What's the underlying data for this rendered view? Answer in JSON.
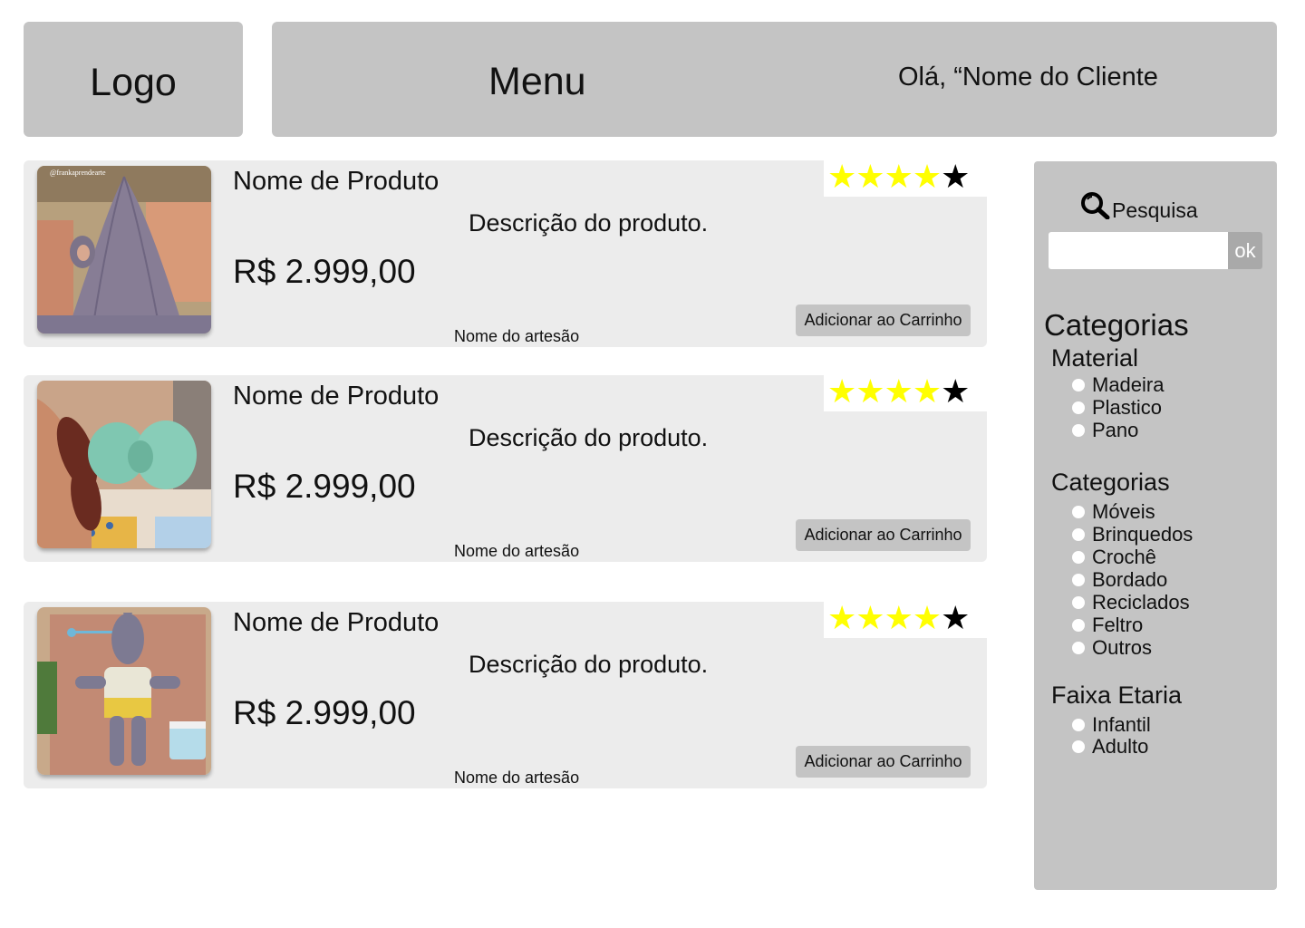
{
  "header": {
    "logo": "Logo",
    "menu": "Menu",
    "greeting": "Olá, “Nome do Cliente"
  },
  "products": [
    {
      "name": "Nome de Produto",
      "description": "Descrição do produto.",
      "price": "R$ 2.999,00",
      "artisan": "Nome do artesão",
      "cart_label": "Adicionar ao Carrinho",
      "rating": 4,
      "rating_max": 5,
      "image": "crochet-gray-pointed-hood",
      "image_caption": "@frankaprendearte"
    },
    {
      "name": "Nome de Produto",
      "description": "Descrição do produto.",
      "price": "R$ 2.999,00",
      "artisan": "Nome do artesão",
      "cart_label": "Adicionar ao Carrinho",
      "rating": 4,
      "rating_max": 5,
      "image": "crochet-mint-bow-held-in-hand"
    },
    {
      "name": "Nome de Produto",
      "description": "Descrição do produto.",
      "price": "R$ 2.999,00",
      "artisan": "Nome do artesão",
      "cart_label": "Adicionar ao Carrinho",
      "rating": 4,
      "rating_max": 5,
      "image": "crochet-rhino-doll-on-blanket"
    }
  ],
  "sidebar": {
    "search_label": "Pesquisa",
    "search_icon": "search-icon",
    "search_value": "",
    "ok_label": "ok",
    "categories_title": "Categorias",
    "groups": [
      {
        "title": "Material",
        "options": [
          "Madeira",
          "Plastico",
          "Pano"
        ]
      },
      {
        "title": "Categorias",
        "options": [
          "Móveis",
          "Brinquedos",
          "Crochê",
          "Bordado",
          "Reciclados",
          "Feltro",
          "Outros"
        ]
      },
      {
        "title": "Faixa Etaria",
        "options": [
          "Infantil",
          "Adulto"
        ]
      }
    ]
  },
  "colors": {
    "panel": "#c4c4c4",
    "card": "#ececec",
    "star_on": "#ffff00",
    "star_off": "#000000",
    "ok_button": "#a9a9a9"
  }
}
